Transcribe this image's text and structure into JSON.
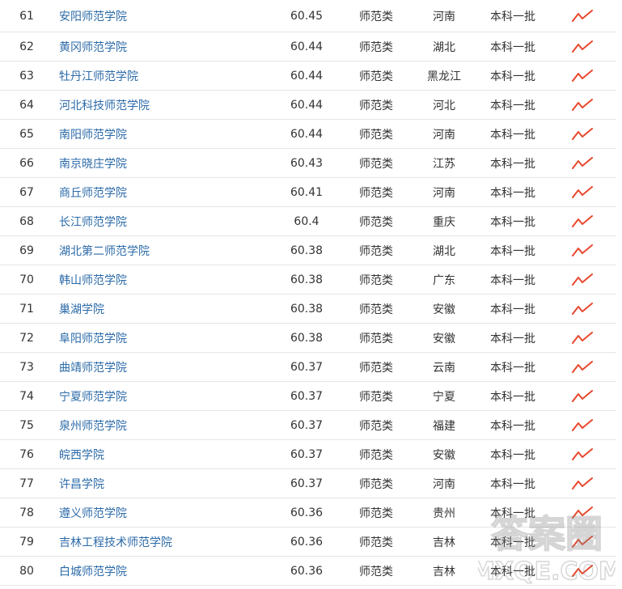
{
  "table": {
    "trend_icon": "trend-line-icon",
    "trend_color": "#e8482e",
    "link_color": "#2b6aa8",
    "rows": [
      {
        "rank": "61",
        "name": "安阳师范学院",
        "score": "60.45",
        "type": "师范类",
        "province": "河南",
        "batch": "本科一批"
      },
      {
        "rank": "62",
        "name": "黄冈师范学院",
        "score": "60.44",
        "type": "师范类",
        "province": "湖北",
        "batch": "本科一批"
      },
      {
        "rank": "63",
        "name": "牡丹江师范学院",
        "score": "60.44",
        "type": "师范类",
        "province": "黑龙江",
        "batch": "本科一批"
      },
      {
        "rank": "64",
        "name": "河北科技师范学院",
        "score": "60.44",
        "type": "师范类",
        "province": "河北",
        "batch": "本科一批"
      },
      {
        "rank": "65",
        "name": "南阳师范学院",
        "score": "60.44",
        "type": "师范类",
        "province": "河南",
        "batch": "本科一批"
      },
      {
        "rank": "66",
        "name": "南京晓庄学院",
        "score": "60.43",
        "type": "师范类",
        "province": "江苏",
        "batch": "本科一批"
      },
      {
        "rank": "67",
        "name": "商丘师范学院",
        "score": "60.41",
        "type": "师范类",
        "province": "河南",
        "batch": "本科一批"
      },
      {
        "rank": "68",
        "name": "长江师范学院",
        "score": "60.4",
        "type": "师范类",
        "province": "重庆",
        "batch": "本科一批"
      },
      {
        "rank": "69",
        "name": "湖北第二师范学院",
        "score": "60.38",
        "type": "师范类",
        "province": "湖北",
        "batch": "本科一批"
      },
      {
        "rank": "70",
        "name": "韩山师范学院",
        "score": "60.38",
        "type": "师范类",
        "province": "广东",
        "batch": "本科一批"
      },
      {
        "rank": "71",
        "name": "巢湖学院",
        "score": "60.38",
        "type": "师范类",
        "province": "安徽",
        "batch": "本科一批"
      },
      {
        "rank": "72",
        "name": "阜阳师范学院",
        "score": "60.38",
        "type": "师范类",
        "province": "安徽",
        "batch": "本科一批"
      },
      {
        "rank": "73",
        "name": "曲靖师范学院",
        "score": "60.37",
        "type": "师范类",
        "province": "云南",
        "batch": "本科一批"
      },
      {
        "rank": "74",
        "name": "宁夏师范学院",
        "score": "60.37",
        "type": "师范类",
        "province": "宁夏",
        "batch": "本科一批"
      },
      {
        "rank": "75",
        "name": "泉州师范学院",
        "score": "60.37",
        "type": "师范类",
        "province": "福建",
        "batch": "本科一批"
      },
      {
        "rank": "76",
        "name": "皖西学院",
        "score": "60.37",
        "type": "师范类",
        "province": "安徽",
        "batch": "本科一批"
      },
      {
        "rank": "77",
        "name": "许昌学院",
        "score": "60.37",
        "type": "师范类",
        "province": "河南",
        "batch": "本科一批"
      },
      {
        "rank": "78",
        "name": "遵义师范学院",
        "score": "60.36",
        "type": "师范类",
        "province": "贵州",
        "batch": "本科一批"
      },
      {
        "rank": "79",
        "name": "吉林工程技术师范学院",
        "score": "60.36",
        "type": "师范类",
        "province": "吉林",
        "batch": "本科一批"
      },
      {
        "rank": "80",
        "name": "白城师范学院",
        "score": "60.36",
        "type": "师范类",
        "province": "吉林",
        "batch": "本科一批"
      }
    ]
  },
  "watermark": {
    "text": "答案圈",
    "domain": "MXQE.COM"
  }
}
